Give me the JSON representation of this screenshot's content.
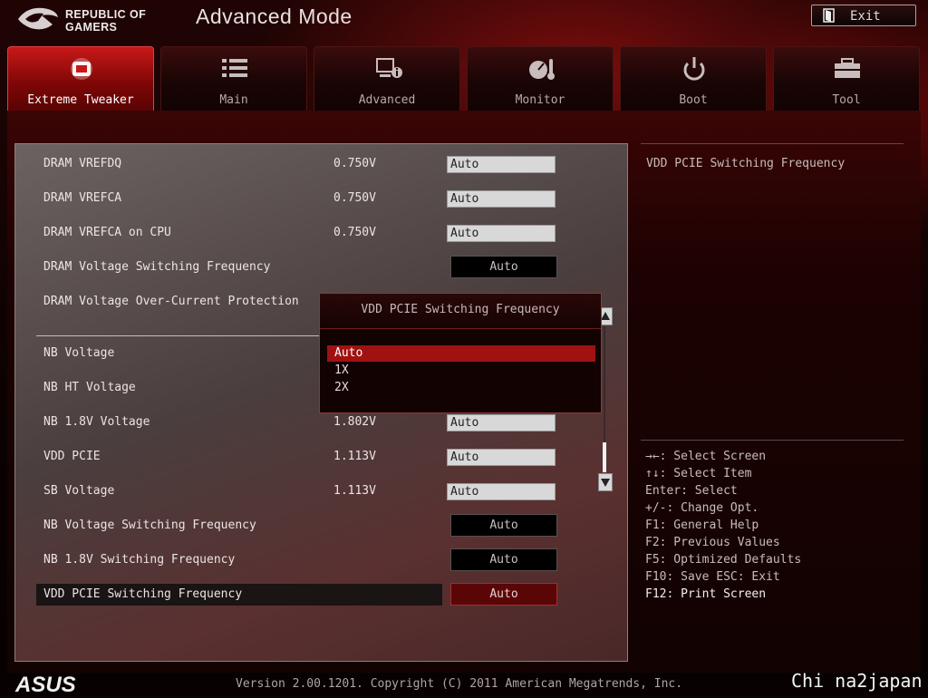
{
  "header": {
    "brand_line1": "REPUBLIC OF",
    "brand_line2": "GAMERS",
    "mode_title": "Advanced Mode",
    "exit_label": "Exit"
  },
  "tabs": [
    {
      "label": "Extreme Tweaker",
      "icon": "tweaker-icon",
      "active": true
    },
    {
      "label": "Main",
      "icon": "list-icon",
      "active": false
    },
    {
      "label": "Advanced",
      "icon": "advanced-info-icon",
      "active": false
    },
    {
      "label": "Monitor",
      "icon": "monitor-gauge-icon",
      "active": false
    },
    {
      "label": "Boot",
      "icon": "power-icon",
      "active": false
    },
    {
      "label": "Tool",
      "icon": "toolbox-icon",
      "active": false
    }
  ],
  "settings": [
    {
      "label": "DRAM VREFDQ",
      "value": "0.750V",
      "field": "Auto",
      "field_type": "input"
    },
    {
      "label": "DRAM VREFCA",
      "value": "0.750V",
      "field": "Auto",
      "field_type": "input"
    },
    {
      "label": "DRAM VREFCA on CPU",
      "value": "0.750V",
      "field": "Auto",
      "field_type": "input"
    },
    {
      "label": "DRAM Voltage Switching Frequency",
      "value": "",
      "field": "Auto",
      "field_type": "select"
    },
    {
      "label": "DRAM Voltage Over-Current Protection",
      "value": "",
      "field": "",
      "field_type": "select"
    },
    {
      "label": "NB Voltage",
      "value": "",
      "field": "",
      "field_type": "input"
    },
    {
      "label": "NB HT Voltage",
      "value": "",
      "field": "",
      "field_type": "input"
    },
    {
      "label": "NB 1.8V Voltage",
      "value": "1.802V",
      "field": "Auto",
      "field_type": "input"
    },
    {
      "label": "VDD PCIE",
      "value": "1.113V",
      "field": "Auto",
      "field_type": "input"
    },
    {
      "label": "SB Voltage",
      "value": "1.113V",
      "field": "Auto",
      "field_type": "input"
    },
    {
      "label": "NB Voltage Switching Frequency",
      "value": "",
      "field": "Auto",
      "field_type": "select"
    },
    {
      "label": "NB 1.8V Switching Frequency",
      "value": "",
      "field": "Auto",
      "field_type": "select"
    },
    {
      "label": "VDD PCIE Switching Frequency",
      "value": "",
      "field": "Auto",
      "field_type": "select",
      "selected": true
    }
  ],
  "popup": {
    "title": "VDD PCIE Switching Frequency",
    "options": [
      "Auto",
      "1X",
      "2X"
    ],
    "highlighted": "Auto"
  },
  "help": {
    "text": "VDD PCIE Switching Frequency"
  },
  "keys": [
    {
      "text": "→←: Select Screen",
      "bright": false
    },
    {
      "text": "↑↓: Select Item",
      "bright": false
    },
    {
      "text": "Enter: Select",
      "bright": false
    },
    {
      "text": "+/-: Change Opt.",
      "bright": false
    },
    {
      "text": "F1: General Help",
      "bright": false
    },
    {
      "text": "F2: Previous Values",
      "bright": false
    },
    {
      "text": "F5: Optimized Defaults",
      "bright": false
    },
    {
      "text": "F10: Save  ESC: Exit",
      "bright": false
    },
    {
      "text": "F12: Print Screen",
      "bright": true
    }
  ],
  "footer": {
    "vendor": "ASUS",
    "version": "Version 2.00.1201. Copyright (C) 2011 American Megatrends, Inc.",
    "watermark": "Chi na2japan"
  },
  "colors": {
    "accent": "#c81818",
    "panel": "#4a3e3e",
    "highlight": "#a01212"
  }
}
